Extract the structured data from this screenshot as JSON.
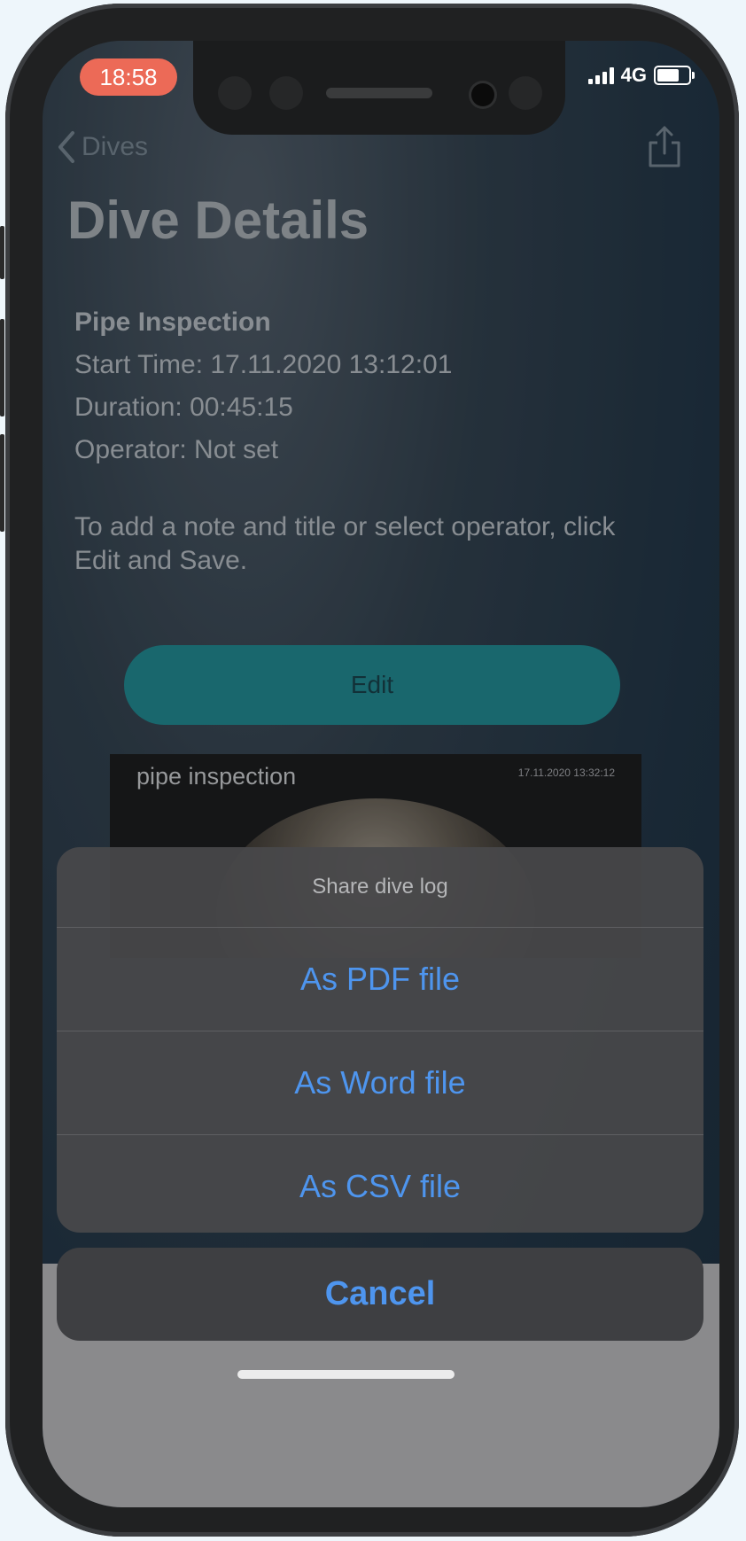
{
  "status_bar": {
    "time": "18:58",
    "network": "4G"
  },
  "nav": {
    "back_label": "Dives"
  },
  "page": {
    "title": "Dive Details"
  },
  "dive": {
    "name": "Pipe Inspection",
    "start_time": "Start Time: 17.11.2020 13:12:01",
    "duration": "Duration: 00:45:15",
    "operator": "Operator: Not set"
  },
  "hint_text": "To add a note and title or select operator, click Edit and Save.",
  "edit_button": "Edit",
  "preview": {
    "title": "pipe inspection",
    "timestamp": "17.11.2020 13:32:12"
  },
  "action_sheet": {
    "title": "Share dive log",
    "options": [
      {
        "label": "As PDF file"
      },
      {
        "label": "As Word file"
      },
      {
        "label": "As CSV file"
      }
    ],
    "cancel": "Cancel"
  },
  "colors": {
    "accent_blue": "#4e95ee",
    "edit_teal": "#1f7e85",
    "time_pill": "#ec6a57"
  }
}
